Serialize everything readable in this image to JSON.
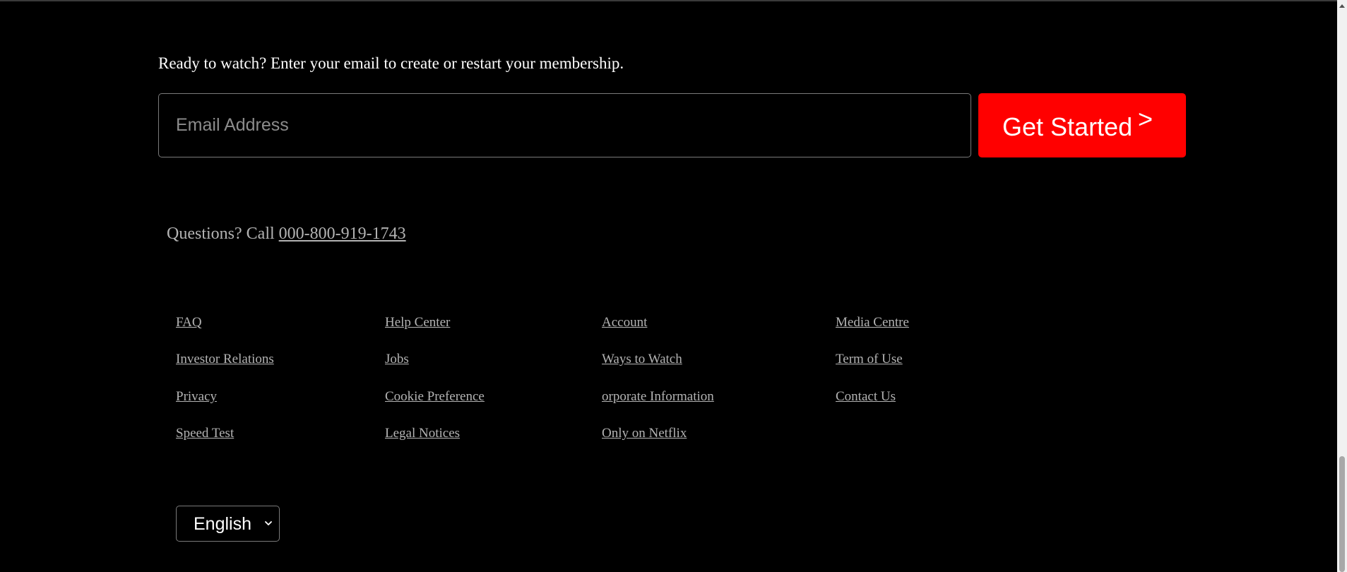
{
  "cta": {
    "text": "Ready to watch? Enter your email to create or restart your membership.",
    "email_placeholder": "Email Address",
    "email_value": "",
    "button_label": "Get Started",
    "button_arrow": ">"
  },
  "contact": {
    "prefix": "Questions? Call ",
    "phone": "000-800-919-1743"
  },
  "footer": {
    "links": [
      "FAQ",
      "Investor Relations",
      "Privacy",
      "Speed Test",
      "Help Center",
      "Jobs",
      "Cookie Preference",
      "Legal Notices",
      "Account",
      "Ways to Watch",
      "orporate Information",
      "Only on Netflix",
      "Media Centre",
      "Term of Use",
      "Contact Us"
    ]
  },
  "language": {
    "selected": "English"
  },
  "icons": {
    "arrow": "chevron-right-icon",
    "dropdown": "chevron-down-icon",
    "scroll_up": "triangle-up-icon"
  },
  "colors": {
    "background": "#000000",
    "accent": "#ff0000",
    "link": "#b3b3b3",
    "border": "#7a7a7a"
  }
}
